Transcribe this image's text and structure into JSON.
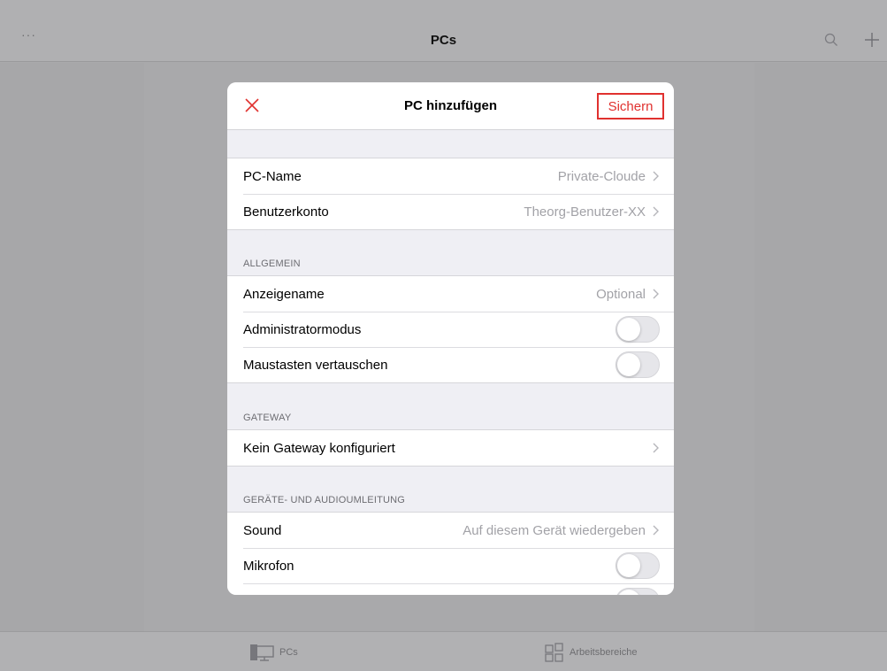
{
  "app": {
    "nav": {
      "more": "···",
      "title": "PCs"
    },
    "tabbar": {
      "tabs": [
        {
          "label": "PCs"
        },
        {
          "label": "Arbeitsbereiche"
        }
      ]
    }
  },
  "modal": {
    "title": "PC hinzufügen",
    "save_label": "Sichern",
    "save_color": "#e0312f",
    "top_group": [
      {
        "label": "PC-Name",
        "value": "Private-Cloude"
      },
      {
        "label": "Benutzerkonto",
        "value": "Theorg-Benutzer-XX"
      }
    ],
    "sections": {
      "general": {
        "title": "ALLGEMEIN",
        "display_name": {
          "label": "Anzeigename",
          "value": "Optional"
        },
        "admin_mode": {
          "label": "Administratormodus",
          "on": false
        },
        "swap_mouse": {
          "label": "Maustasten vertauschen",
          "on": false
        }
      },
      "gateway": {
        "title": "GATEWAY",
        "row": {
          "label": "Kein Gateway konfiguriert"
        }
      },
      "devices": {
        "title": "GERÄTE- UND AUDIOUMLEITUNG",
        "sound": {
          "label": "Sound",
          "value": "Auf diesem Gerät wiedergeben"
        },
        "microphone": {
          "label": "Mikrofon",
          "on": false
        }
      }
    }
  }
}
